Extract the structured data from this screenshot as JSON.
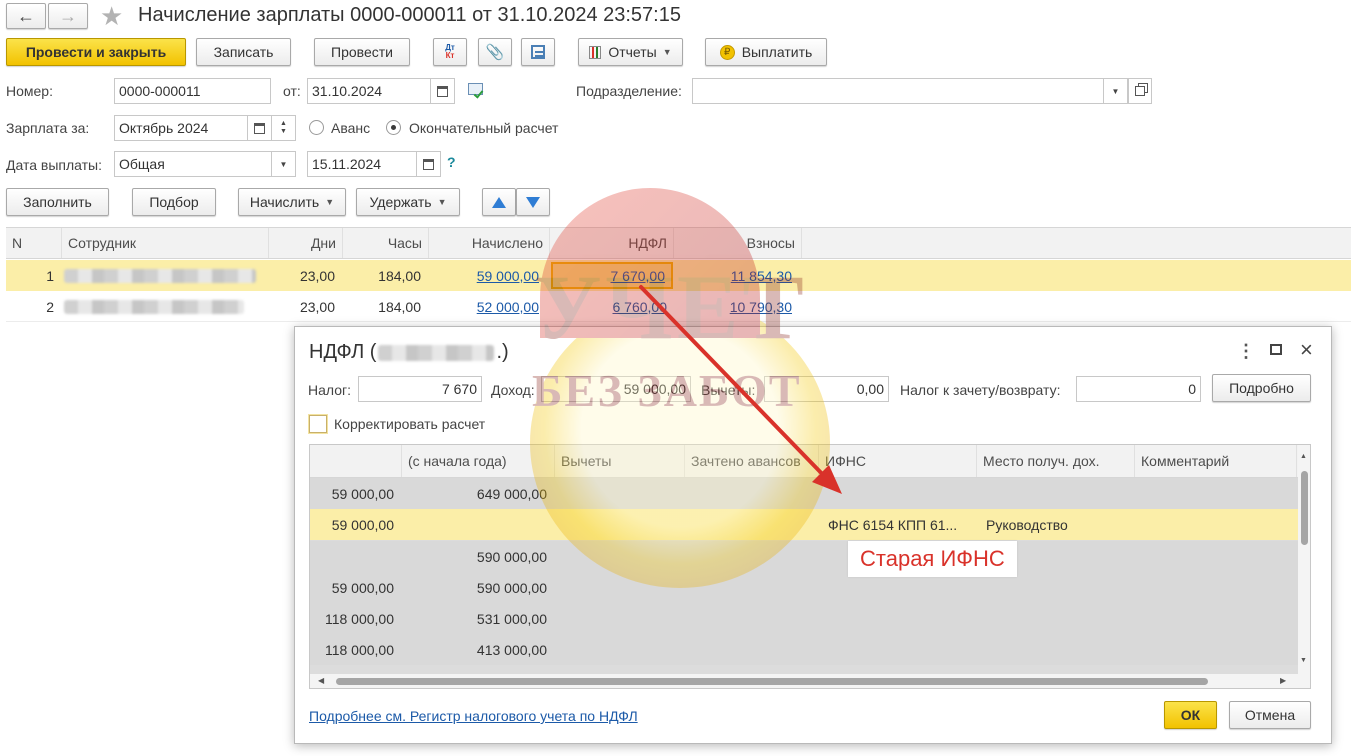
{
  "window": {
    "title": "Начисление зарплаты 0000-000011 от 31.10.2024 23:57:15"
  },
  "toolbar": {
    "post_close": "Провести и закрыть",
    "save": "Записать",
    "post": "Провести",
    "reports": "Отчеты",
    "pay": "Выплатить"
  },
  "form": {
    "number_label": "Номер:",
    "number": "0000-000011",
    "from_label": "от:",
    "date": "31.10.2024",
    "dept_label": "Подразделение:",
    "dept_value": "",
    "period_label": "Зарплата за:",
    "period": "Октябрь 2024",
    "radio_advance": "Аванс",
    "radio_final": "Окончательный расчет",
    "paydate_label": "Дата выплаты:",
    "paytype": "Общая",
    "paydate": "15.11.2024",
    "help": "?"
  },
  "actions": {
    "fill": "Заполнить",
    "select": "Подбор",
    "accrue": "Начислить",
    "withhold": "Удержать"
  },
  "main_table": {
    "headers": [
      "N",
      "Сотрудник",
      "Дни",
      "Часы",
      "Начислено",
      "НДФЛ",
      "Взносы"
    ],
    "rows": [
      {
        "n": "1",
        "days": "23,00",
        "hours": "184,00",
        "accrued": "59 000,00",
        "ndfl": "7 670,00",
        "contrib": "11 854,30"
      },
      {
        "n": "2",
        "days": "23,00",
        "hours": "184,00",
        "accrued": "52 000,00",
        "ndfl": "6 760,00",
        "contrib": "10 790,30"
      }
    ]
  },
  "dialog": {
    "title_prefix": "НДФЛ (",
    "title_suffix": ".)",
    "tax_label": "Налог:",
    "tax": "7 670",
    "income_label": "Доход:",
    "income": "59 000,00",
    "deductions_label": "Вычеты:",
    "deductions": "0,00",
    "refund_label": "Налог к зачету/возврату:",
    "refund": "0",
    "details_button": "Подробно",
    "correct_label": "Корректировать расчет",
    "headers": [
      "",
      "(с начала года)",
      "Вычеты",
      "Зачтено авансов",
      "ИФНС",
      "Место получ. дох.",
      "Комментарий"
    ],
    "rows": [
      {
        "c1": "59 000,00",
        "c2": "649 000,00",
        "ifns": "",
        "place": ""
      },
      {
        "c1": "59 000,00",
        "c2": "",
        "ifns": "ФНС 6154 КПП 61...",
        "place": "Руководство"
      },
      {
        "c1": "",
        "c2": "590 000,00",
        "ifns": "",
        "place": ""
      },
      {
        "c1": "59 000,00",
        "c2": "590 000,00",
        "ifns": "",
        "place": ""
      },
      {
        "c1": "118 000,00",
        "c2": "531 000,00",
        "ifns": "",
        "place": ""
      },
      {
        "c1": "118 000,00",
        "c2": "413 000,00",
        "ifns": "",
        "place": ""
      }
    ],
    "footer_link": "Подробнее см. Регистр налогового учета по НДФЛ",
    "ok": "ОК",
    "cancel": "Отмена"
  },
  "annotation": {
    "text": "Старая ИФНС",
    "color": "#d9322a"
  },
  "watermark": {
    "line1": "УЧЕТ",
    "line2": "БЕЗ ЗАБОТ"
  },
  "colors": {
    "accent_yellow": "#f5c800",
    "selected_row": "#fbeea8",
    "link": "#1c5aa8"
  }
}
